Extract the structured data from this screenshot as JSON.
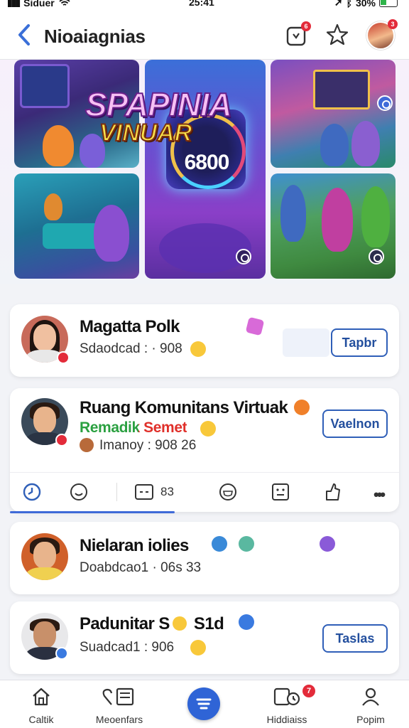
{
  "status_bar": {
    "carrier": "Siduer",
    "time": "25:41",
    "battery": "30%"
  },
  "header": {
    "title": "Nioaiagnias",
    "notif_count": "6",
    "profile_count": "3"
  },
  "banner": {
    "title": "SPAPINIA",
    "subtitle": "VINUAR",
    "screen_value": "6800"
  },
  "cards": [
    {
      "name": "Magatta Polk",
      "meta": "Sdaodcad : · 908",
      "button": "Tapbr"
    },
    {
      "name": "Ruang Komunitans Virtuak",
      "subline": "Remadik Semet",
      "meta": "Imanoy : 908 26",
      "button": "Vaelnon",
      "actions": {
        "count": "83"
      }
    },
    {
      "name": "Nielaran iolies",
      "meta": "Doabdcao1 · 06s 33"
    },
    {
      "name": "Padunitar S",
      "name_suffix": "S1d",
      "meta": "Suadcad1 : 906",
      "button": "Taslas"
    }
  ],
  "bottom_nav": [
    {
      "label": "Caltik",
      "icon": "home-icon"
    },
    {
      "label": "Meoenfars",
      "icon": "heart-book-icon"
    },
    {
      "label": "",
      "icon": "feed-icon"
    },
    {
      "label": "Hiddiaiss",
      "icon": "clock-chat-icon",
      "badge": "7"
    },
    {
      "label": "Popim",
      "icon": "profile-icon"
    }
  ],
  "colors": {
    "accent": "#2f64d6",
    "badge": "#e32b3a",
    "button_border": "#2f5fb8"
  }
}
